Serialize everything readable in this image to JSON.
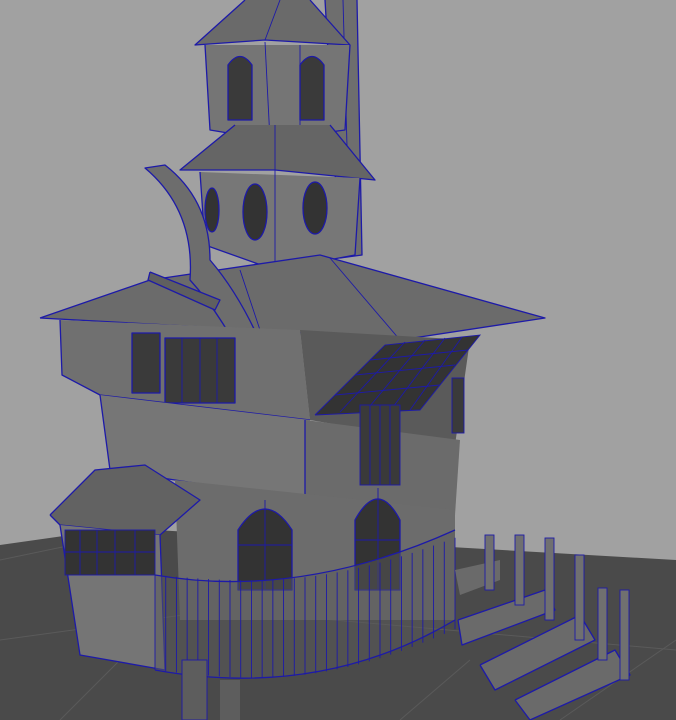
{
  "viewport": {
    "background": "#a1a1a1",
    "ground_color": "#4a4a4a",
    "grid_line_color": "#5a5a5a",
    "wireframe_color": "#1d1aa8",
    "model_light": "#7a7a7a",
    "model_mid": "#696969",
    "model_dark": "#4d4d4d",
    "window_dark": "#2a2a2a"
  }
}
